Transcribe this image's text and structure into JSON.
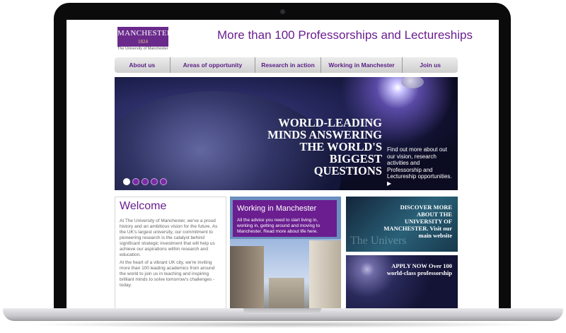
{
  "header": {
    "logo_main": "MANCHESTER",
    "logo_year": "1824",
    "logo_sub": "The University of Manchester",
    "title": "More than 100 Professorships and Lectureships"
  },
  "nav": {
    "items": [
      "About us",
      "Areas of opportunity",
      "Research in action",
      "Working in Manchester",
      "Join us"
    ]
  },
  "hero": {
    "heading": "WORLD-LEADING MINDS ANSWERING THE WORLD'S BIGGEST QUESTIONS",
    "text": "Find out more about out our vision, research activities and Professorship and Lectureship opportunities. ▶",
    "slides": 5,
    "active_slide": 1
  },
  "welcome": {
    "title": "Welcome",
    "p1": "At The University of Manchester, we've a proud history and an ambitious vision for the future. As the UK's largest university, our commitment to pioneering research is the catalyst behind significant strategic investment that will help us achieve our aspirations within research and education.",
    "p2": "At the heart of a vibrant UK city, we're inviting more than 100 leading academics from around the world to join us in teaching and inspiring brilliant minds to solve tomorrow's challenges - today."
  },
  "working": {
    "title": "Working in Manchester",
    "text": "All the advice you need to start living in, working in, getting around and moving to Manchester. Read more about life here."
  },
  "tiles": {
    "discover": "DISCOVER MORE ABOUT THE UNIVERSITY OF MANCHESTER. Visit our main website",
    "discover_watermark": "The Univers",
    "apply": "APPLY NOW Over 100 world-class professorship"
  },
  "colors": {
    "brand_purple": "#6a1e8f",
    "nav_bg": "#d9d9d9"
  }
}
